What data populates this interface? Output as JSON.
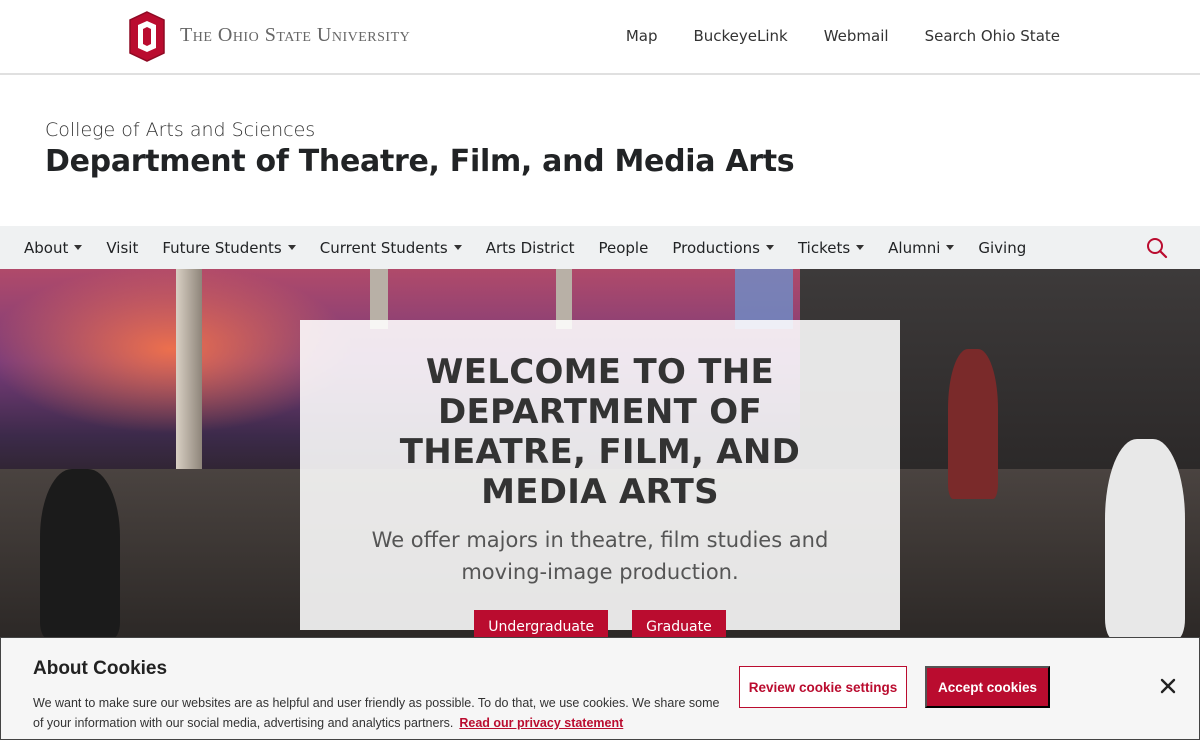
{
  "osu_bar": {
    "wordmark": "The Ohio State University",
    "links": [
      "Map",
      "BuckeyeLink",
      "Webmail",
      "Search Ohio State"
    ]
  },
  "site_header": {
    "college": "College of Arts and Sciences",
    "department": "Department of Theatre, Film, and Media Arts"
  },
  "main_nav": {
    "items": [
      {
        "label": "About",
        "dropdown": true
      },
      {
        "label": "Visit",
        "dropdown": false
      },
      {
        "label": "Future Students",
        "dropdown": true
      },
      {
        "label": "Current Students",
        "dropdown": true
      },
      {
        "label": "Arts District",
        "dropdown": false
      },
      {
        "label": "People",
        "dropdown": false
      },
      {
        "label": "Productions",
        "dropdown": true
      },
      {
        "label": "Tickets",
        "dropdown": true
      },
      {
        "label": "Alumni",
        "dropdown": true
      },
      {
        "label": "Giving",
        "dropdown": false
      }
    ],
    "search_icon": "search-icon"
  },
  "hero": {
    "title": "WELCOME TO THE DEPARTMENT OF THEATRE, FILM, AND MEDIA ARTS",
    "subtitle": "We offer majors in theatre, film studies and moving-image production.",
    "buttons": [
      "Undergraduate",
      "Graduate"
    ]
  },
  "cookie_banner": {
    "title": "About Cookies",
    "text": "We want to make sure our websites are as helpful and user friendly as possible. To do that, we use cookies. We share some of your information with our social media, advertising and analytics partners.",
    "privacy_link": "Read our privacy statement",
    "review_button": "Review cookie settings",
    "accept_button": "Accept cookies",
    "close_icon": "close-icon"
  },
  "colors": {
    "scarlet": "#ba0c2f",
    "nav_bg": "#eff1f2",
    "text_dark": "#212325"
  }
}
